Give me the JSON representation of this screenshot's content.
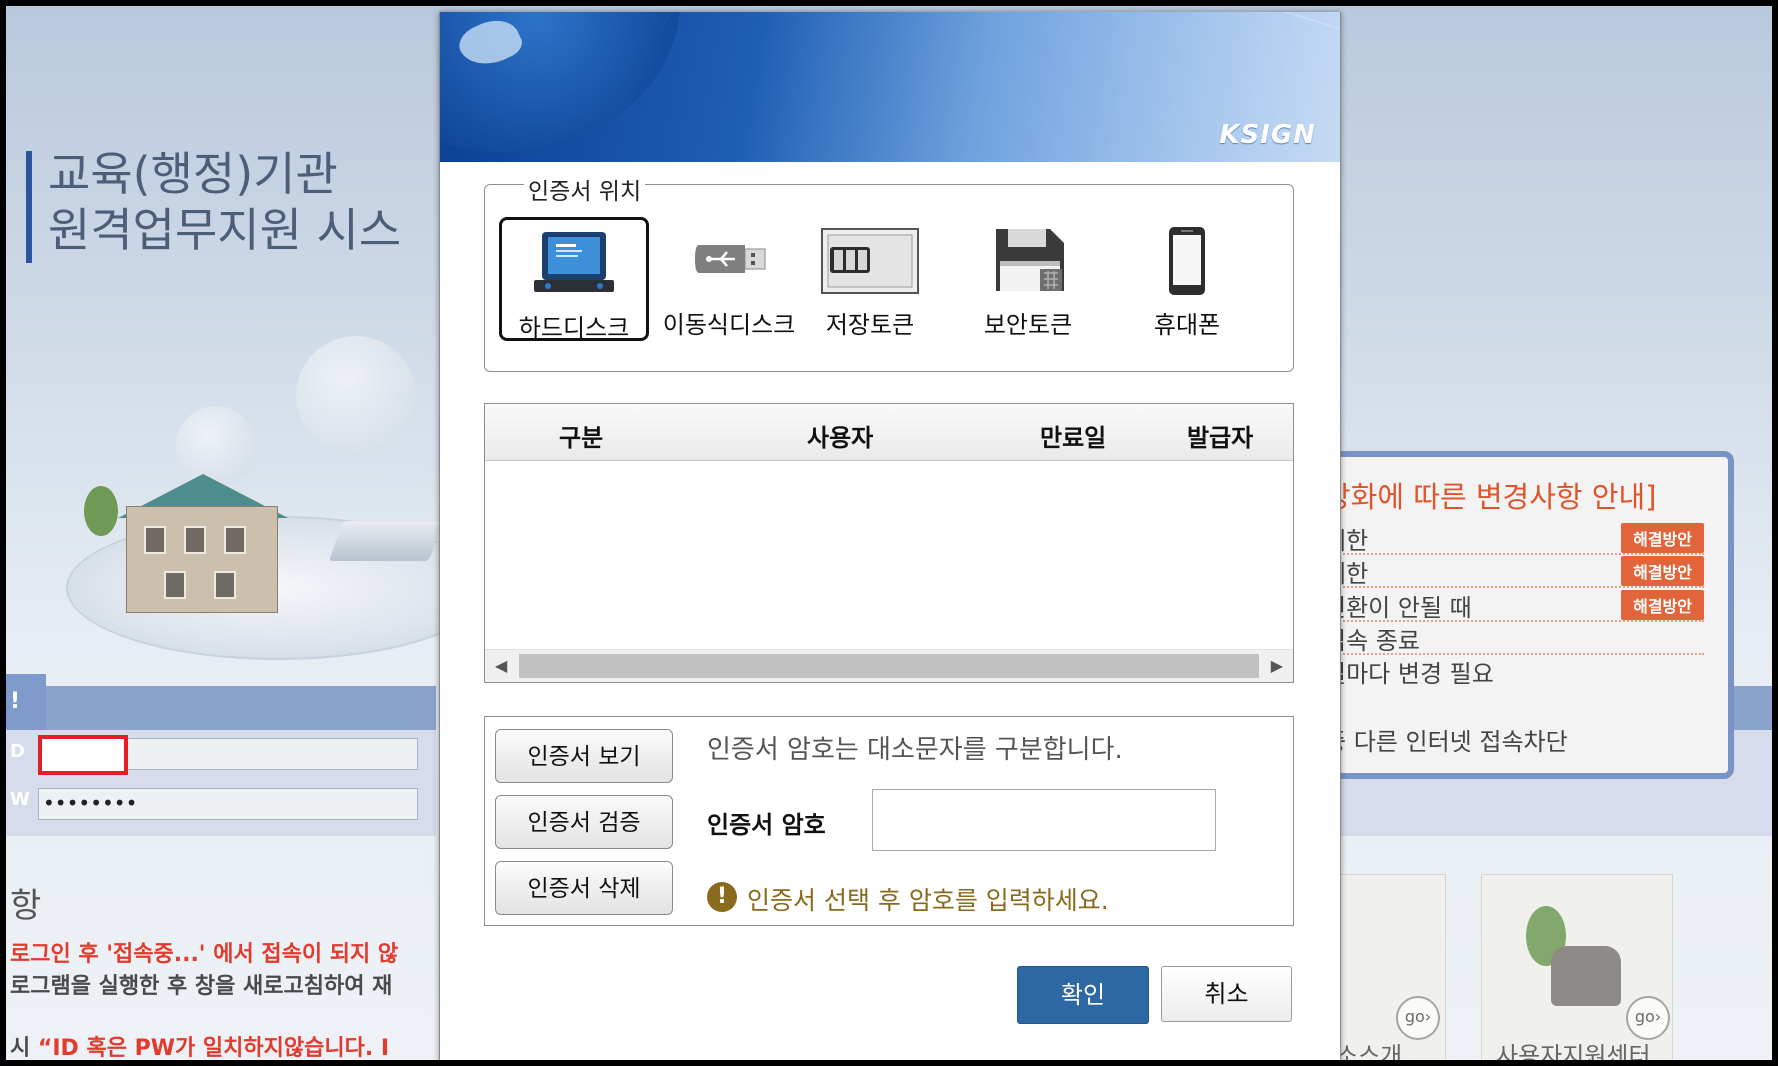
{
  "background": {
    "site_title_line1": "교육(행정)기관",
    "site_title_line2": "원격업무지원 시스",
    "login_tab": "!",
    "id_label": "D",
    "pw_label": "W",
    "pw_masked": "••••••••",
    "notice_heading": "항",
    "notice_line1": "로그인 후 '접속중...' 에서 접속이 되지 않",
    "notice_line2": "로그램을 실행한 후 창을 새로고침하여 재",
    "notice_line3_prefix": "시 ",
    "notice_line3_red": "“ID 혹은 PW가 일치하지않습니다. I",
    "info_title": "강화에 따른 변경사항 안내]",
    "info_rows": [
      {
        "text": "제한",
        "badge": "해결방안"
      },
      {
        "text": " 제한",
        "badge": "해결방안"
      },
      {
        "text": "변환이 안될 때",
        "badge": "해결방안"
      },
      {
        "text": "접속 종료",
        "badge": ""
      },
      {
        "text": "일마다 변경 필요",
        "badge": ""
      }
    ],
    "info_last": "중 다른 인터넷 접속차단",
    "card_go": "go›",
    "card1_label": "소스개",
    "card2_label": "사용자지원센터"
  },
  "dialog": {
    "brand_logo": "KSIGN",
    "location_legend": "인증서 위치",
    "locations": [
      {
        "label": "하드디스크",
        "icon": "hard-disk-icon",
        "selected": true
      },
      {
        "label": "이동식디스크",
        "icon": "usb-drive-icon",
        "selected": false
      },
      {
        "label": "저장토큰",
        "icon": "storage-token-icon",
        "selected": false
      },
      {
        "label": "보안토큰",
        "icon": "security-token-icon",
        "selected": false
      },
      {
        "label": "휴대폰",
        "icon": "mobile-phone-icon",
        "selected": false
      }
    ],
    "table_columns": [
      "구분",
      "사용자",
      "만료일",
      "발급자"
    ],
    "table_rows": [],
    "buttons": {
      "view_cert": "인증서 보기",
      "verify_cert": "인증서 검증",
      "delete_cert": "인증서 삭제",
      "ok": "확인",
      "cancel": "취소"
    },
    "password_hint": "인증서 암호는 대소문자를 구분합니다.",
    "password_label": "인증서 암호",
    "password_value": "",
    "warning_text": "인증서 선택 후 암호를 입력하세요.",
    "colors": {
      "primary_button": "#2d68a4",
      "warning": "#8a6a1c",
      "highlight_red": "#e21f26"
    }
  }
}
